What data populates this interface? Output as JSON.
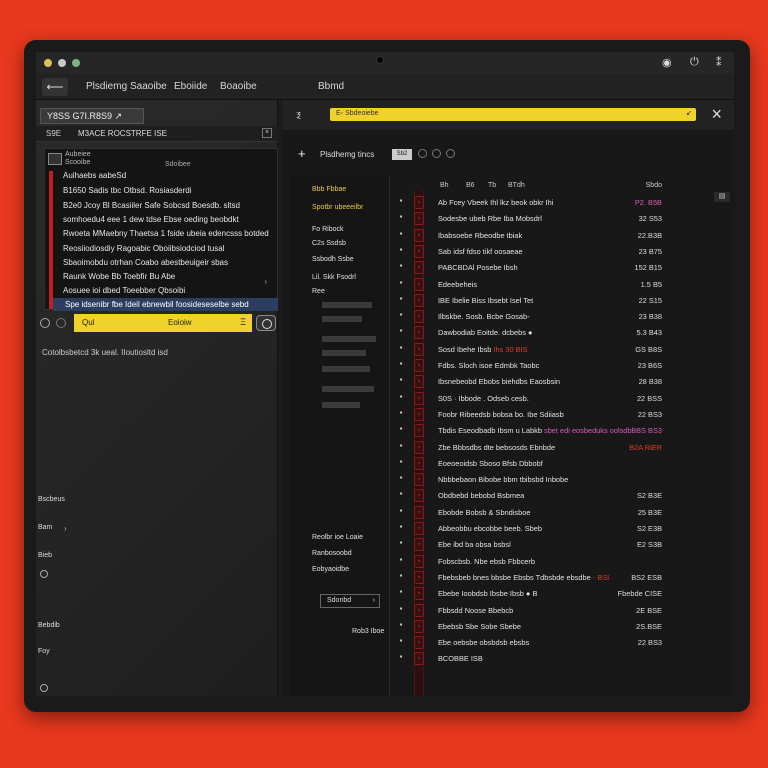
{
  "titlebar": {
    "icons": [
      "camera-icon",
      "power-icon",
      "pin-icon"
    ]
  },
  "menu": {
    "back_label": "⟵",
    "items": [
      "Plsdiemg",
      "Saaoibe",
      "Eboiide",
      "Boaoibe",
      "Bbmd"
    ]
  },
  "left": {
    "tab_label": "Y8SS G7I.R8S9 ↗",
    "header_left": "S9E",
    "header_right": "M3ACE ROCSTRFE ISE",
    "header_close": "×",
    "card_caption": "Aubeiee\nScooibe",
    "card_caption2": "Sdoibee",
    "rows": [
      "Auihaebs aabeSd",
      "B1650 Sadis tbc Otbsd. Rosiasderdi",
      "B2e0 Jcoy Bl Bcasiiler Safe Sobcsd Boesdb. sltsd",
      "somhoedu4 eee 1 dew tdse Ebse oeding beobdkt",
      "Rwoeta MMaebny Thaetsa 1 fside ubeia edencsss botded",
      "Reosiiodiosdiy Ragoabic Oboiibsiodciod tusal",
      "Sbaoimobdu otrhan Coabo abestbeuigeir sbas",
      "Raunk Wobe Bb Toebfir Bu Abe",
      "Aosuee ioi dbed Toeebber Qbsoibi",
      "Spe idsenibr fbe Ideil ebnewbil foosideseselbe sebd"
    ],
    "search_left": "Qul",
    "search_value": "Eoioiw",
    "search_end": "Ξ",
    "note": "Cotolbsbetcd 3k ueal. IIoutiosltd isd",
    "side_labels": [
      "Bscbeus",
      "Bam",
      "Bieb",
      "Bebdib",
      "Foy"
    ]
  },
  "right": {
    "addr_icon": "Ⲝ",
    "url_text": "E◦ Sbdeoiebe",
    "url_end": "↙",
    "close": "×",
    "toolbar_label": "Plsdhemg tincs",
    "toolbar_badge": "Sb2",
    "subcol": {
      "y1": "Bbb Fbbae",
      "y2": "Spotbr ubeeeilbr",
      "w1": "Fo Ribock",
      "w2": "C2s Ssdsb",
      "w3": "Ssbodh Ssbe",
      "w4": "Lil. Skk Fsodrl",
      "w5": "Ree",
      "bottom1": "Reolbr ioe Loaie",
      "bottom2": "Ranbosoobd",
      "bottom3": "Eobyaoidbe",
      "btn_label": "Sdonbd",
      "btn_chevron": "›",
      "bottom4": "Rob3 Iboe"
    },
    "table_head": [
      "Bh",
      "B6",
      "Tb",
      "BTdh"
    ],
    "table_head_right": "Sbdo",
    "scroll_label": "▤",
    "rows": [
      {
        "name": "Ab Fcey Vbeek Ihl lkz beok obkr Ihi",
        "value": "P2. B5B",
        "style": "pink"
      },
      {
        "name": "Sodesbe ubeb Rbe Iba Mobsdrl",
        "value": "32 S53",
        "style": ""
      },
      {
        "name": "Ibabsoebe Rbeodbe tbiak",
        "value": "22.B3B",
        "style": ""
      },
      {
        "name": "Sab idsf fdso tikf oosaeae",
        "value": "23 B75",
        "style": ""
      },
      {
        "name": "PABCBDAl Posebe Ibsh",
        "value": "152 B15",
        "style": ""
      },
      {
        "name": "Edeebeheis",
        "value": "1.5 B5",
        "style": ""
      },
      {
        "name": "IBE Ibelie Biss Ibsebt Isel Tet",
        "value": "22 S15",
        "style": ""
      },
      {
        "name": "Ilbskbe. Sosb. Bcbe Gosab-",
        "value": "23 B38",
        "style": ""
      },
      {
        "name": "Dawbodiab Eoitde. dcbebs ●",
        "value": "5.3 B43",
        "style": ""
      },
      {
        "name": "Sosd Ibehe Ibsb",
        "name_hl": "Ihs 30 BIS",
        "value": "GS B8S",
        "style": ""
      },
      {
        "name": "Fdbs. Sloch isoe Edmbk Taobc",
        "value": "23 B6S",
        "style": ""
      },
      {
        "name": "Ibsnebeobd Ebobs biehdbs Eaosbsin",
        "value": "28 B38",
        "style": ""
      },
      {
        "name": "S0S · Ibbode . Odseb cesb.",
        "value": "22 BSS",
        "style": ""
      },
      {
        "name": "Foobr Ribeedsb bobsa bo. Ibe Sdiiasb",
        "value": "22 BS3",
        "style": ""
      },
      {
        "name": "Tbdis Eseodbadb Ibsm u Labkb",
        "name_hl": "sbet edi eosbeduks oolsdbi",
        "value": "BBS BS3",
        "style": "pink"
      },
      {
        "name": "Zbe Bbbsdbs dte bebsosds Ebnbde",
        "value": "B2A RiER",
        "style": "red"
      },
      {
        "name": "Eoeoeoidsb Sboso Bfsb Dbbobf",
        "value": "",
        "style": ""
      },
      {
        "name": "Nbbbebaon Bibobe bbm tbibsbd Inbobe",
        "value": "",
        "style": ""
      },
      {
        "name": "Obdbebd bebobd Bsbmea",
        "value": "S2 B3E",
        "style": ""
      },
      {
        "name": "Ebobde Bobsb & Sbndisboe",
        "value": "25 B3E",
        "style": ""
      },
      {
        "name": "Abbeobbu ebcobbe beeb. Sbeb",
        "value": "S2 E3B",
        "style": ""
      },
      {
        "name": "Ebe ibd ba obsa bsbsl",
        "value": "E2 S3B",
        "style": ""
      },
      {
        "name": "Fobscbsb. Nbe ebsb Fbbcerb",
        "value": "",
        "style": ""
      },
      {
        "name": "Fbebsbeb bnes bbsbe Ebsbs Tdbsbde ebsdbe",
        "name_hl": "- BSI",
        "value": "BS2 ESB",
        "style": ""
      },
      {
        "name": "Ebebe Ioobdsb Ibsbe Ibsb ● B",
        "value": "Fbebde CISE",
        "style": ""
      },
      {
        "name": "Fbbsdd Noose Bbebcb",
        "value": "2E BSE",
        "style": ""
      },
      {
        "name": "Ebebsb Sbe Sobe Sbebe",
        "value": "2S.BSE",
        "style": ""
      },
      {
        "name": "Ebe oebsbe obsbdsb ebsbs",
        "value": "22 BS3",
        "style": ""
      },
      {
        "name": "BCOBBE ISB",
        "value": "",
        "style": ""
      }
    ]
  },
  "colors": {
    "background": "#e8381e",
    "accent_yellow": "#f1d22b",
    "accent_red": "#c41d1d"
  }
}
